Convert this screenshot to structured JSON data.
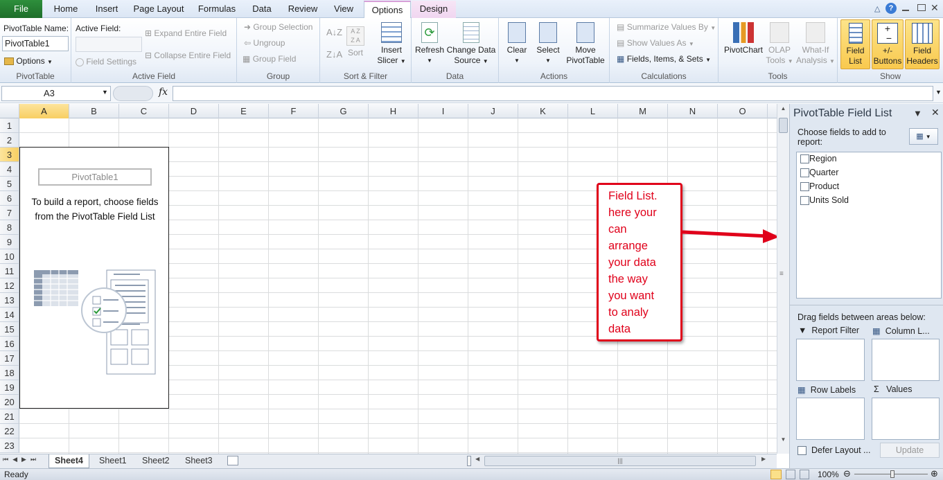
{
  "tabs": {
    "file": "File",
    "home": "Home",
    "insert": "Insert",
    "page_layout": "Page Layout",
    "formulas": "Formulas",
    "data": "Data",
    "review": "Review",
    "view": "View",
    "options": "Options",
    "design": "Design"
  },
  "ribbon": {
    "pivottable": {
      "name_label": "PivotTable Name:",
      "name_value": "PivotTable1",
      "options": "Options",
      "group_label": "PivotTable"
    },
    "active_field": {
      "label": "Active Field:",
      "field_settings": "Field Settings",
      "expand": "Expand Entire Field",
      "collapse": "Collapse Entire Field",
      "group_label": "Active Field"
    },
    "group": {
      "group_selection": "Group Selection",
      "ungroup": "Ungroup",
      "group_field": "Group Field",
      "group_label": "Group"
    },
    "sort_filter": {
      "sort": "Sort",
      "insert": "Insert",
      "slicer": "Slicer",
      "group_label": "Sort & Filter"
    },
    "data": {
      "refresh": "Refresh",
      "change_data": "Change Data",
      "source": "Source",
      "group_label": "Data"
    },
    "actions": {
      "clear": "Clear",
      "select": "Select",
      "move": "Move",
      "pivottable": "PivotTable",
      "group_label": "Actions"
    },
    "calculations": {
      "summarize": "Summarize Values By",
      "show_values": "Show Values As",
      "fields_items": "Fields, Items, & Sets",
      "group_label": "Calculations"
    },
    "tools": {
      "pivotchart": "PivotChart",
      "olap": "OLAP",
      "olap2": "Tools",
      "whatif": "What-If",
      "whatif2": "Analysis",
      "group_label": "Tools"
    },
    "show": {
      "field": "Field",
      "list": "List",
      "plusminus": "+/-",
      "buttons": "Buttons",
      "field2": "Field",
      "headers": "Headers",
      "group_label": "Show"
    }
  },
  "formula_bar": {
    "name_box": "A3",
    "fx": "fx",
    "formula": ""
  },
  "columns": [
    "A",
    "B",
    "C",
    "D",
    "E",
    "F",
    "G",
    "H",
    "I",
    "J",
    "K",
    "L",
    "M",
    "N",
    "O"
  ],
  "rows": [
    "1",
    "2",
    "3",
    "4",
    "5",
    "6",
    "7",
    "8",
    "9",
    "10",
    "11",
    "12",
    "13",
    "14",
    "15",
    "16",
    "17",
    "18",
    "19",
    "20",
    "21",
    "22",
    "23"
  ],
  "pivot_placeholder": {
    "name": "PivotTable1",
    "line1": "To build a report, choose fields",
    "line2": "from the PivotTable Field List"
  },
  "callout": {
    "lines": [
      "Field List.",
      "here your",
      "can",
      "arrange",
      "your data",
      "the way",
      "you want",
      "to analy",
      "data"
    ],
    "color": "#e0001a"
  },
  "sheets": [
    "Sheet4",
    "Sheet1",
    "Sheet2",
    "Sheet3"
  ],
  "status": {
    "ready": "Ready",
    "zoom": "100%"
  },
  "field_list": {
    "title": "PivotTable Field List",
    "choose": "Choose fields to add to",
    "report": "report:",
    "fields": [
      "Region",
      "Quarter",
      "Product",
      "Units Sold"
    ],
    "drag": "Drag fields between areas below:",
    "report_filter": "Report Filter",
    "column_labels": "Column L...",
    "row_labels": "Row Labels",
    "values": "Values",
    "defer": "Defer Layout ...",
    "update": "Update"
  }
}
